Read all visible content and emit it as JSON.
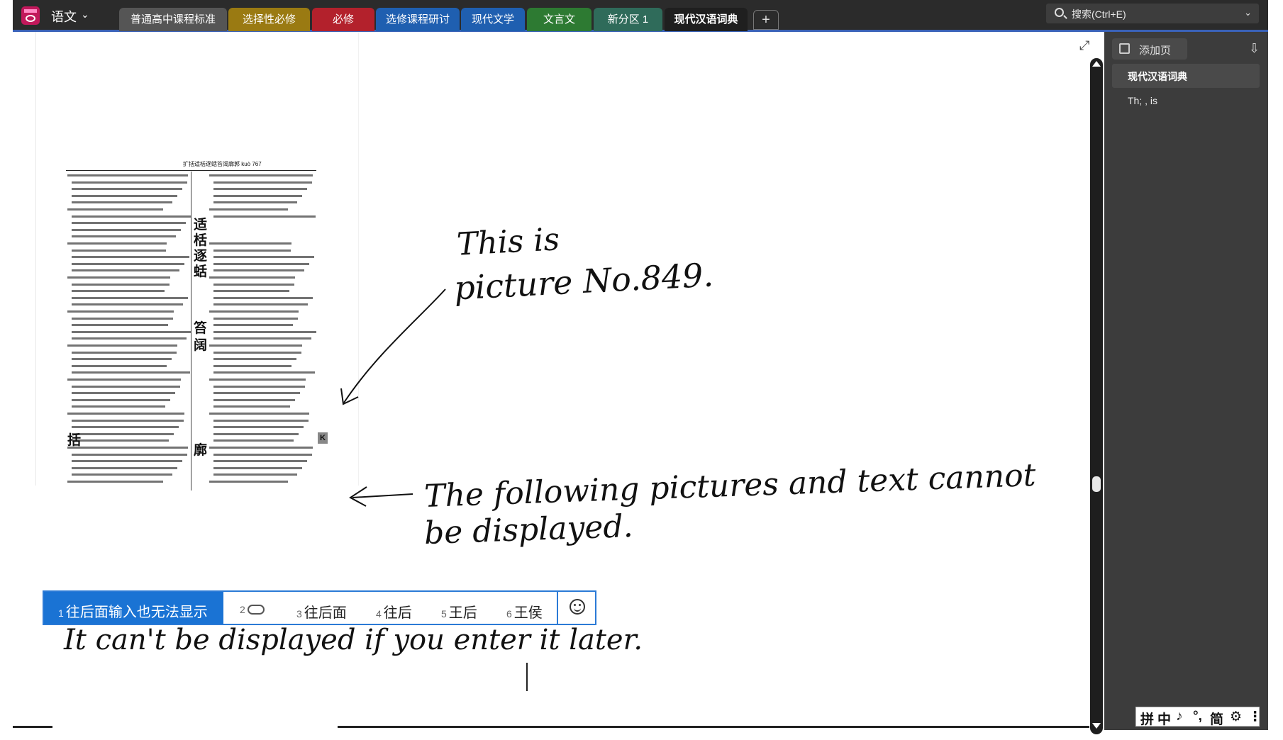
{
  "app": {
    "notebook_name": "语文"
  },
  "tabs": [
    {
      "label": "普通高中课程标准",
      "color": "#555555"
    },
    {
      "label": "选择性必修",
      "color": "#9a7a12"
    },
    {
      "label": "必修",
      "color": "#b3212c"
    },
    {
      "label": "选修课程研讨",
      "color": "#1f5fb0"
    },
    {
      "label": "现代文学",
      "color": "#1f5fb0"
    },
    {
      "label": "文言文",
      "color": "#2d7a32"
    },
    {
      "label": "新分区 1",
      "color": "#2f6b5a"
    },
    {
      "label": "现代汉语词典",
      "color": "#1f1f1f",
      "active": true
    }
  ],
  "tab_add_label": "+",
  "search": {
    "placeholder": "搜索(Ctrl+E)"
  },
  "pane": {
    "add_page_label": "添加页",
    "pages": [
      {
        "label": "现代汉语词典",
        "selected": true
      },
      {
        "label": "Th; , is",
        "selected": false
      }
    ]
  },
  "scan": {
    "header": "扩括适栝逐蛞笞阔廓郭   kuò   767",
    "characters": [
      "适",
      "栝",
      "逐",
      "蛞",
      "笞",
      "阔",
      "括",
      "廓"
    ],
    "marker": "K"
  },
  "annotations": {
    "note1_line1": "This is",
    "note1_line2": "picture No.849.",
    "note2_line1": "The following pictures and text cannot",
    "note2_line2": "be displayed.",
    "note3": "It can't be displayed if you enter it later."
  },
  "ime": {
    "candidates": [
      {
        "num": "1",
        "text": "往后面输入也无法显示"
      },
      {
        "num": "2",
        "text": ""
      },
      {
        "num": "3",
        "text": "往后面"
      },
      {
        "num": "4",
        "text": "往后"
      },
      {
        "num": "5",
        "text": "王后"
      },
      {
        "num": "6",
        "text": "王侯"
      }
    ],
    "cloud_icon": "cloud-icon",
    "emoji_icon": "emoji-icon"
  },
  "ime_status": {
    "items": [
      "拼",
      "中",
      "♪",
      "°,",
      "简",
      "⚙",
      "⋮"
    ]
  },
  "colors": {
    "accent": "#2b7ad6",
    "ime_selected": "#1a73d4",
    "topbar": "#2b2b2b",
    "pane": "#3c3c3c"
  }
}
